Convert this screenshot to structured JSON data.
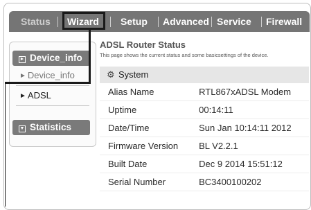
{
  "nav": {
    "items": [
      {
        "label": "Status"
      },
      {
        "label": "Wizard"
      },
      {
        "label": "Setup"
      },
      {
        "label": "Advanced"
      },
      {
        "label": "Service"
      },
      {
        "label": "Firewall"
      }
    ]
  },
  "sidebar": {
    "device_info_label": "Device_info",
    "device_info_link": "Device_info",
    "adsl_link": "ADSL",
    "statistics_label": "Statistics"
  },
  "main": {
    "title": "ADSL Router Status",
    "description": "This page shows the current status and some basicsettings of the device.",
    "section_label": "System",
    "rows": [
      {
        "label": "Alias Name",
        "value": "RTL867xADSL Modem"
      },
      {
        "label": "Uptime",
        "value": "00:14:11"
      },
      {
        "label": "Date/Time",
        "value": "Sun Jan 10:14:11 2012"
      },
      {
        "label": "Firmware Version",
        "value": "BL V2.2.1"
      },
      {
        "label": "Built Date",
        "value": "Dec 9 2014 15:51:12"
      },
      {
        "label": "Serial Number",
        "value": "BC3400100202"
      }
    ]
  }
}
